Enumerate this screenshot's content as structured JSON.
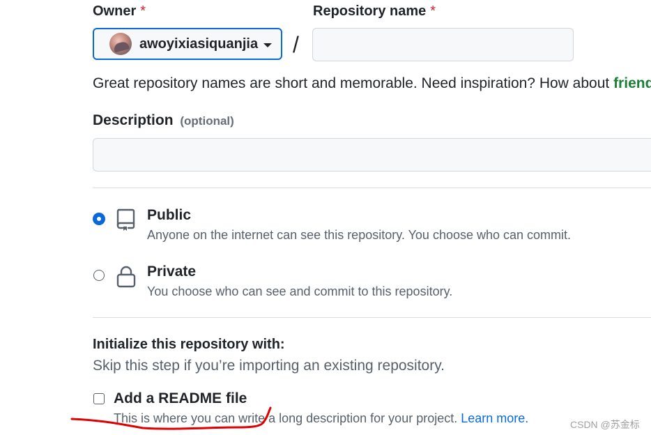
{
  "owner": {
    "label": "Owner",
    "required_mark": "*",
    "selected": "awoyixiasiquanjia"
  },
  "repository": {
    "label": "Repository name",
    "required_mark": "*",
    "separator": "/",
    "value": "",
    "hint_text": "Great repository names are short and memorable. Need inspiration? How about ",
    "hint_suggestion": "friend"
  },
  "description": {
    "label": "Description",
    "optional": "(optional)",
    "value": ""
  },
  "visibility": {
    "public": {
      "title": "Public",
      "desc": "Anyone on the internet can see this repository. You choose who can commit.",
      "checked": true,
      "icon": "repo-icon"
    },
    "private": {
      "title": "Private",
      "desc": "You choose who can see and commit to this repository.",
      "checked": false,
      "icon": "lock-icon"
    }
  },
  "initialize": {
    "title": "Initialize this repository with:",
    "subtitle": "Skip this step if you’re importing an existing repository.",
    "readme_label": "Add a README file",
    "readme_desc": "This is where you can write a long description for your project.",
    "learn_more": "Learn more."
  },
  "colors": {
    "accent": "#0969da",
    "required": "#cf222e",
    "suggestion": "#1a7f37",
    "annotation": "#e00000"
  },
  "watermark": "CSDN @苏金标"
}
